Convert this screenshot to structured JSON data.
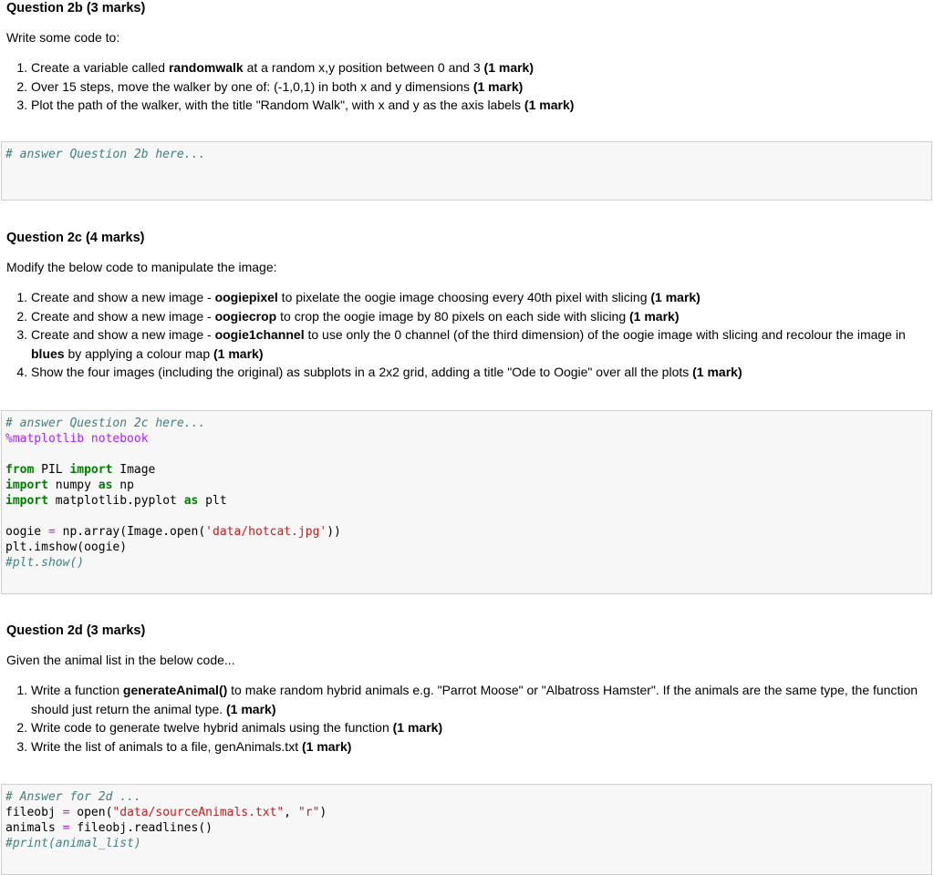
{
  "q2b": {
    "title_bold": "Question 2b",
    "title_rest": " (3 marks)",
    "intro": "Write some code to:",
    "items": [
      {
        "pre": "Create a variable called ",
        "bold": "randomwalk",
        "post": " at a random x,y position between 0 and 3 ",
        "mark": "(1 mark)"
      },
      {
        "pre": "Over 15 steps, move the walker by one of: (-1,0,1) in both x and y dimensions ",
        "bold": "",
        "post": "",
        "mark": "(1 mark)"
      },
      {
        "pre": "Plot the path of the walker, with the title \"Random Walk\", with x and y as the axis labels ",
        "bold": "",
        "post": "",
        "mark": "(1 mark)"
      }
    ],
    "code_comment": "# answer Question 2b here..."
  },
  "q2c": {
    "title_bold": "Question 2c",
    "title_rest": " (4 marks)",
    "intro": "Modify the below code to manipulate the image:",
    "items": [
      {
        "pre": "Create and show a new image - ",
        "bold": "oogiepixel",
        "post": " to pixelate the oogie image choosing every 40th pixel with slicing ",
        "mark": "(1 mark)"
      },
      {
        "pre": "Create and show a new image - ",
        "bold": "oogiecrop",
        "post": " to crop the oogie image by 80 pixels on each side with slicing ",
        "mark": "(1 mark)"
      },
      {
        "pre": "Create and show a new image - ",
        "bold": "oogie1channel",
        "post": " to use only the 0 channel (of the third dimension) of the oogie image with slicing and recolour the image in ",
        "bold2": "blues",
        "post2": " by applying a colour map ",
        "mark": "(1 mark)"
      },
      {
        "pre": "Show the four images (including the original) as subplots in a 2x2 grid, adding a title \"Ode to Oogie\" over all the plots ",
        "bold": "",
        "post": "",
        "mark": "(1 mark)"
      }
    ],
    "code": {
      "l1": "# answer Question 2c here...",
      "l2": "%matplotlib notebook",
      "l3_kw1": "from",
      "l3_mod": " PIL ",
      "l3_kw2": "import",
      "l3_rest": " Image",
      "l4_kw1": "import",
      "l4_mod": " numpy ",
      "l4_kw2": "as",
      "l4_rest": " np",
      "l5_kw1": "import",
      "l5_mod": " matplotlib.pyplot ",
      "l5_kw2": "as",
      "l5_rest": " plt",
      "l6_a": "oogie ",
      "l6_eq": "=",
      "l6_b": " np.array(Image.open(",
      "l6_str": "'data/hotcat.jpg'",
      "l6_c": "))",
      "l7": "plt.imshow(oogie)",
      "l8": "#plt.show()"
    }
  },
  "q2d": {
    "title_bold": "Question 2d",
    "title_rest": " (3 marks)",
    "intro": "Given the animal list in the below code...",
    "items": [
      {
        "pre": "Write a function ",
        "bold": "generateAnimal()",
        "post": " to make random hybrid animals e.g. \"Parrot Moose\" or \"Albatross Hamster\". If the animals are the same type, the function should just return the animal type. ",
        "mark": "(1 mark)"
      },
      {
        "pre": "Write code to generate twelve hybrid animals using the function ",
        "bold": "",
        "post": "",
        "mark": "(1 mark)"
      },
      {
        "pre": "Write the list of animals to a file, genAnimals.txt ",
        "bold": "",
        "post": "",
        "mark": "(1 mark)"
      }
    ],
    "code": {
      "l1": "# Answer for 2d ...",
      "l2_a": "fileobj ",
      "l2_eq": "=",
      "l2_b": " open(",
      "l2_s1": "\"data/sourceAnimals.txt\"",
      "l2_c": ", ",
      "l2_s2": "\"r\"",
      "l2_d": ")",
      "l3_a": "animals ",
      "l3_eq": "=",
      "l3_b": " fileobj.readlines()",
      "l4": "#print(animal_list)"
    }
  }
}
